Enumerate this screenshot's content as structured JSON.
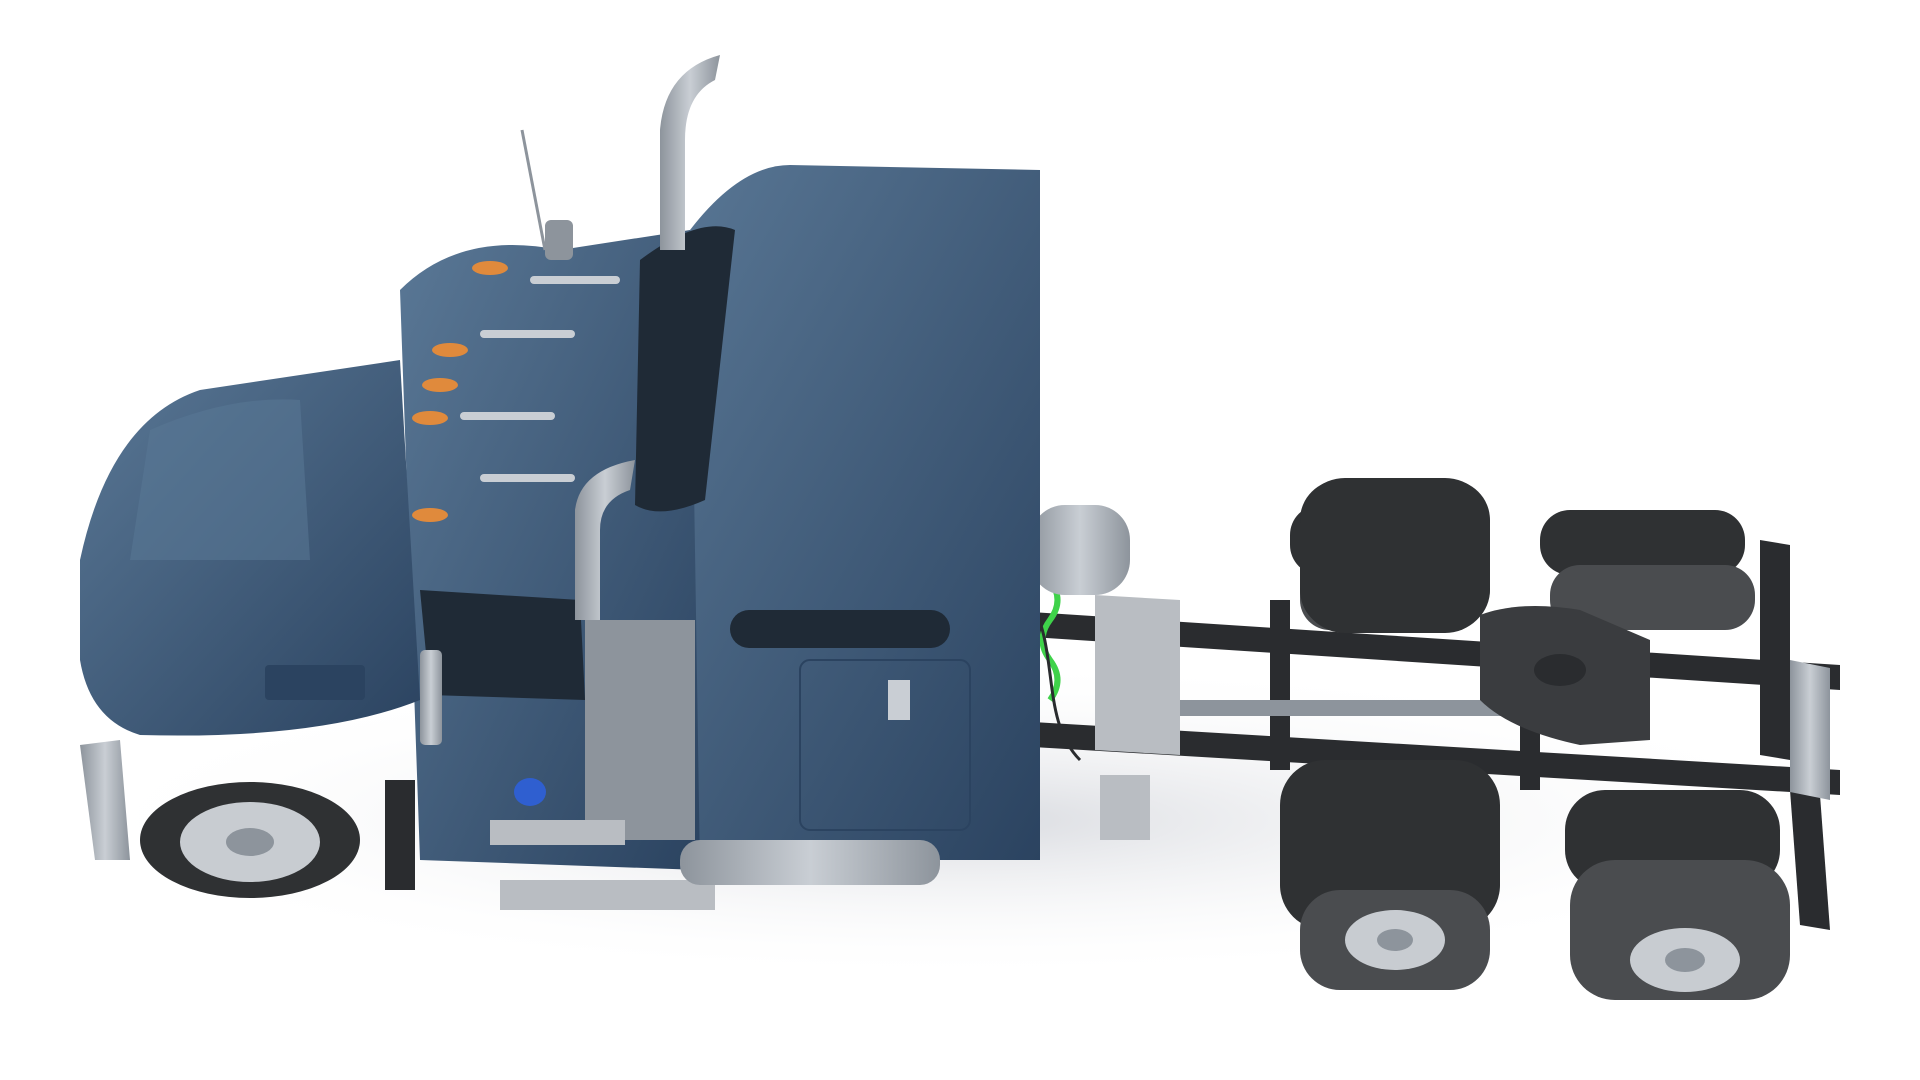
{
  "scene": {
    "subject": "semi-truck-tractor",
    "view": "elevated-three-quarter",
    "colors": {
      "background": "#ffffff",
      "floor": "#f1f2f4",
      "shadow": "#d9dbe0",
      "cab_paint": "#3f5b7a",
      "cab_paint_light": "#5a7896",
      "cab_paint_dark": "#2b4360",
      "chrome": "#c9ced4",
      "chrome_dark": "#8d949c",
      "frame": "#2a2c2f",
      "tire": "#2f3133",
      "tire_tread": "#4a4c4f",
      "rim": "#c8ccd1",
      "glass": "#1f2a36",
      "marker_amber": "#e08a3c",
      "air_line_green": "#3fd24a",
      "deck_plate": "#b9bdc2",
      "fifth_wheel": "#3a3c3f"
    }
  }
}
